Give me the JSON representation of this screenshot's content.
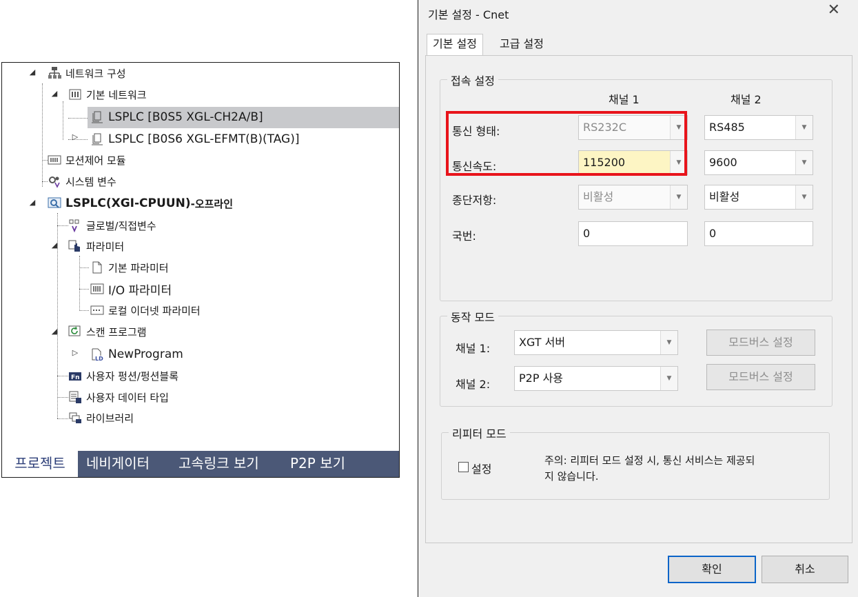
{
  "tree": {
    "items": [
      {
        "label": "네트워크 구성"
      },
      {
        "label": "기본 네트워크"
      },
      {
        "label": "LSPLC [B0S5 XGL-CH2A/B]"
      },
      {
        "label": "LSPLC [B0S6 XGL-EFMT(B)(TAG)]"
      },
      {
        "label": "모션제어 모듈"
      },
      {
        "label": "시스템 변수"
      },
      {
        "label": "LSPLC(XGI-CPUUN)",
        "suffix": "-오프라인"
      },
      {
        "label": "글로벌/직접변수"
      },
      {
        "label": "파라미터"
      },
      {
        "label": "기본 파라미터"
      },
      {
        "label": "I/O 파라미터"
      },
      {
        "label": "로컬 이더넷 파라미터"
      },
      {
        "label": "스캔 프로그램"
      },
      {
        "label": "NewProgram"
      },
      {
        "label": "사용자 펑션/펑션블록"
      },
      {
        "label": "사용자 데이터 타입"
      },
      {
        "label": "라이브러리"
      }
    ],
    "tabs": [
      "프로젝트",
      "네비게이터",
      "고속링크 보기",
      "P2P 보기"
    ]
  },
  "dialog": {
    "title": "기본 설정 - Cnet",
    "close_glyph": "✕",
    "tabs": [
      "기본 설정",
      "고급 설정"
    ],
    "connection": {
      "legend": "접속 설정",
      "col1": "채널 1",
      "col2": "채널 2",
      "rows": [
        {
          "label": "통신 형태:",
          "ch1": "RS232C",
          "ch2": "RS485"
        },
        {
          "label": "통신속도:",
          "ch1": "115200",
          "ch2": "9600"
        },
        {
          "label": "종단저항:",
          "ch1": "비활성",
          "ch2": "비활성"
        },
        {
          "label": "국번:",
          "ch1": "0",
          "ch2": "0"
        }
      ]
    },
    "op_mode": {
      "legend": "동작 모드",
      "rows": [
        {
          "label": "채널 1:",
          "value": "XGT 서버",
          "button": "모드버스 설정"
        },
        {
          "label": "채널 2:",
          "value": "P2P 사용",
          "button": "모드버스 설정"
        }
      ]
    },
    "repeater": {
      "legend": "리피터 모드",
      "checkbox_label": "설정",
      "checked": false,
      "note": "주의: 리피터 모드 설정 시, 통신 서비스는 제공되지 않습니다.",
      "note_line1": "주의: 리피터 모드 설정 시, 통신 서비스는 제공되",
      "note_line2": "지 않습니다."
    },
    "ok_label": "확인",
    "cancel_label": "취소"
  },
  "colors": {
    "tab_bar": "#4b5877",
    "selection": "#c8c9cc",
    "highlight_box": "#e8141b",
    "active_field": "#fdf5c4"
  }
}
